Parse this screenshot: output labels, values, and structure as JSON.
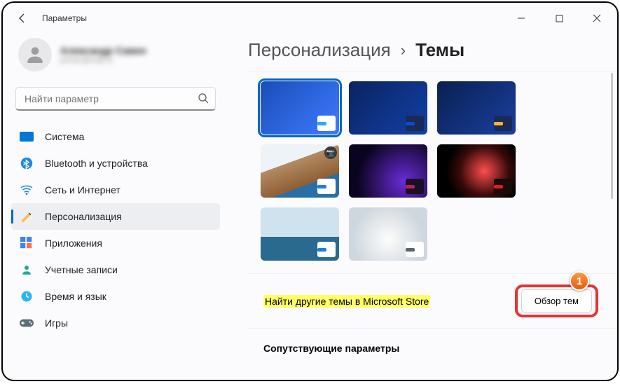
{
  "window": {
    "app_title": "Параметры"
  },
  "user": {
    "display_name": "Александр Савин",
    "email": "primer@mail.ru"
  },
  "search": {
    "placeholder": "Найти параметр"
  },
  "sidebar": {
    "items": [
      {
        "icon": "system",
        "label": "Система"
      },
      {
        "icon": "bt",
        "label": "Bluetooth и устройства"
      },
      {
        "icon": "net",
        "label": "Сеть и Интернет"
      },
      {
        "icon": "pers",
        "label": "Персонализация",
        "active": true
      },
      {
        "icon": "apps",
        "label": "Приложения"
      },
      {
        "icon": "acct",
        "label": "Учетные записи"
      },
      {
        "icon": "time",
        "label": "Время и язык"
      },
      {
        "icon": "game",
        "label": "Игры"
      }
    ]
  },
  "breadcrumb": {
    "parent": "Персонализация",
    "current": "Темы"
  },
  "themes": [
    {
      "bg": "linear-gradient(135deg,#1b4db8,#3d7bff)",
      "accent": "#2aa8ff",
      "selected": true
    },
    {
      "bg": "linear-gradient(135deg,#0b2360,#1140a8)",
      "accent": "#0a4bd6",
      "chip_bg": "#1a2a55"
    },
    {
      "bg": "linear-gradient(135deg,#092050,#1a3fa0)",
      "accent": "#ffb040",
      "chip_bg": "#1a2a55"
    },
    {
      "bg": "linear-gradient(160deg,#eef3f8 35%,#b48b63 35%,#8e5e34 70%,#2a6ea8 70%)",
      "accent": "#1e7fd6",
      "camera": true
    },
    {
      "bg": "radial-gradient(circle at 70% 70%,#6a2bd8,#0b0420 70%)",
      "accent": "#b32455",
      "chip_bg": "#1a1026"
    },
    {
      "bg": "radial-gradient(circle at 60% 50%,#ff4d4d,#3a0a0a 45%,#000 70%)",
      "accent": "#e61b1b",
      "chip_bg": "#1a0a0a"
    },
    {
      "bg": "linear-gradient(#cfe3ef 55%,#2a6a8e 55%)",
      "accent": "#1e7fd6"
    },
    {
      "bg": "radial-gradient(circle at 50% 60%,#fdfdfc,#cfd7de 70%)",
      "accent": "#5b6670"
    }
  ],
  "store": {
    "find_more_label": "Найти другие темы в Microsoft Store",
    "browse_label": "Обзор тем"
  },
  "annotation": {
    "badge": "1"
  },
  "related": {
    "heading": "Сопутствующие параметры"
  }
}
